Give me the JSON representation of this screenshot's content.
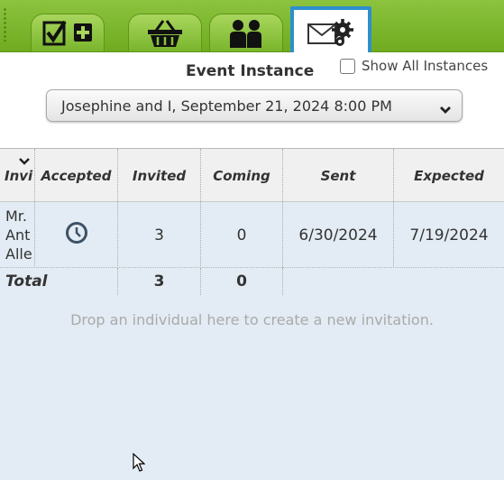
{
  "tabs": [
    {
      "icon": "checklist-add-icon",
      "active": false
    },
    {
      "icon": "basket-icon",
      "active": false
    },
    {
      "icon": "people-icon",
      "active": false
    },
    {
      "icon": "mail-settings-icon",
      "active": true
    }
  ],
  "event_instance": {
    "title": "Event Instance",
    "show_all_label": "Show All Instances",
    "show_all_checked": false,
    "selected": "Josephine and I, September 21, 2024 8:00 PM"
  },
  "table": {
    "columns": [
      "Invi",
      "Accepted",
      "Invited",
      "Coming",
      "Sent",
      "Expected"
    ],
    "rows": [
      {
        "name_lines": [
          "Mr.",
          "Ant",
          "Alle"
        ],
        "accepted_icon": "clock-icon",
        "invited": "3",
        "coming": "0",
        "sent": "6/30/2024",
        "expected": "7/19/2024"
      }
    ],
    "total": {
      "label": "Total",
      "invited": "3",
      "coming": "0"
    },
    "drop_hint": "Drop an individual here to create a new invitation."
  },
  "colors": {
    "tab_green": "#8cc33f",
    "active_tab_border": "#2e8fce",
    "grid_bg": "#e3ecf4"
  }
}
